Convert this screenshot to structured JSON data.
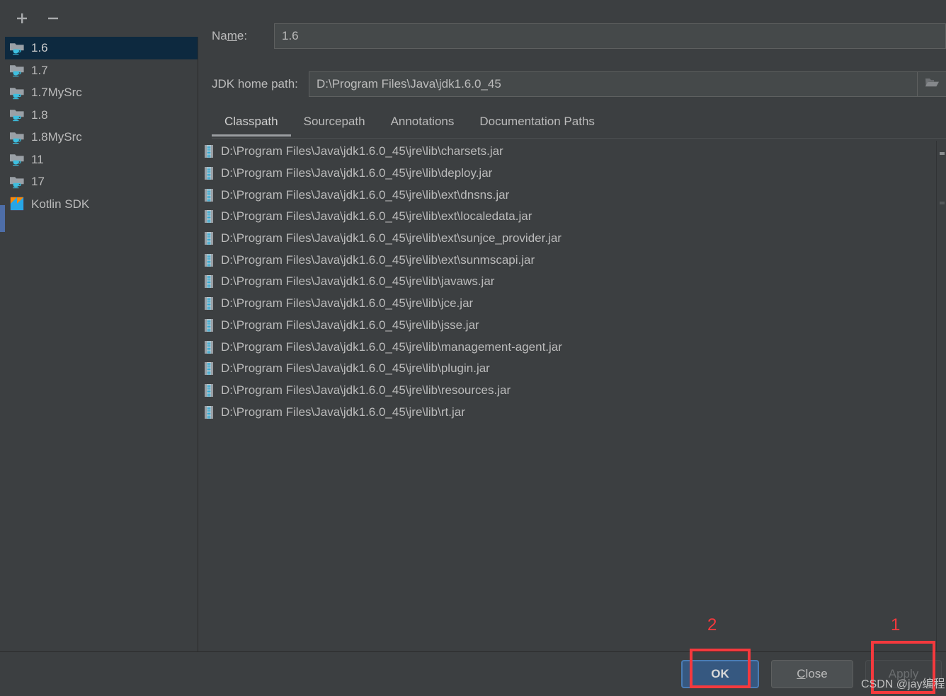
{
  "sidebar": {
    "toolbar": {
      "add_label": "+",
      "remove_label": "-",
      "add_name": "add-sdk-icon",
      "remove_name": "remove-sdk-icon"
    },
    "items": [
      {
        "label": "1.6",
        "icon": "jdk-folder-icon",
        "selected": true
      },
      {
        "label": "1.7",
        "icon": "jdk-folder-icon",
        "selected": false
      },
      {
        "label": "1.7MySrc",
        "icon": "jdk-folder-icon",
        "selected": false
      },
      {
        "label": "1.8",
        "icon": "jdk-folder-icon",
        "selected": false
      },
      {
        "label": "1.8MySrc",
        "icon": "jdk-folder-icon",
        "selected": false
      },
      {
        "label": "11",
        "icon": "jdk-folder-icon",
        "selected": false
      },
      {
        "label": "17",
        "icon": "jdk-folder-icon",
        "selected": false
      },
      {
        "label": "Kotlin SDK",
        "icon": "kotlin-icon",
        "selected": false
      }
    ]
  },
  "form": {
    "name_label": "Name:",
    "name_mnemonic": "m",
    "name_value": "1.6",
    "name_placeholder": "",
    "home_label": "JDK home path:",
    "home_value": "D:\\Program Files\\Java\\jdk1.6.0_45",
    "home_placeholder": "",
    "browse_icon": "folder-open-icon"
  },
  "tabs": [
    {
      "label": "Classpath",
      "active": true
    },
    {
      "label": "Sourcepath",
      "active": false
    },
    {
      "label": "Annotations",
      "active": false
    },
    {
      "label": "Documentation Paths",
      "active": false
    }
  ],
  "classpath": {
    "entries": [
      "D:\\Program Files\\Java\\jdk1.6.0_45\\jre\\lib\\charsets.jar",
      "D:\\Program Files\\Java\\jdk1.6.0_45\\jre\\lib\\deploy.jar",
      "D:\\Program Files\\Java\\jdk1.6.0_45\\jre\\lib\\ext\\dnsns.jar",
      "D:\\Program Files\\Java\\jdk1.6.0_45\\jre\\lib\\ext\\localedata.jar",
      "D:\\Program Files\\Java\\jdk1.6.0_45\\jre\\lib\\ext\\sunjce_provider.jar",
      "D:\\Program Files\\Java\\jdk1.6.0_45\\jre\\lib\\ext\\sunmscapi.jar",
      "D:\\Program Files\\Java\\jdk1.6.0_45\\jre\\lib\\javaws.jar",
      "D:\\Program Files\\Java\\jdk1.6.0_45\\jre\\lib\\jce.jar",
      "D:\\Program Files\\Java\\jdk1.6.0_45\\jre\\lib\\jsse.jar",
      "D:\\Program Files\\Java\\jdk1.6.0_45\\jre\\lib\\management-agent.jar",
      "D:\\Program Files\\Java\\jdk1.6.0_45\\jre\\lib\\plugin.jar",
      "D:\\Program Files\\Java\\jdk1.6.0_45\\jre\\lib\\resources.jar",
      "D:\\Program Files\\Java\\jdk1.6.0_45\\jre\\lib\\rt.jar"
    ],
    "entry_icon": "jar-file-icon"
  },
  "buttons": {
    "ok": "OK",
    "close_prefix": "",
    "close_mnemonic": "C",
    "close_suffix": "lose",
    "apply": "Apply"
  },
  "annotations": {
    "num_1": "1",
    "num_2": "2",
    "color": "#f5393d"
  },
  "watermark": "CSDN @jay编程",
  "colors": {
    "background": "#3c3f41",
    "selection": "#0d293f",
    "field_bg": "#45494a",
    "ok_button": "#365880",
    "text": "#bbbbbb",
    "annotation_red": "#f5393d"
  }
}
